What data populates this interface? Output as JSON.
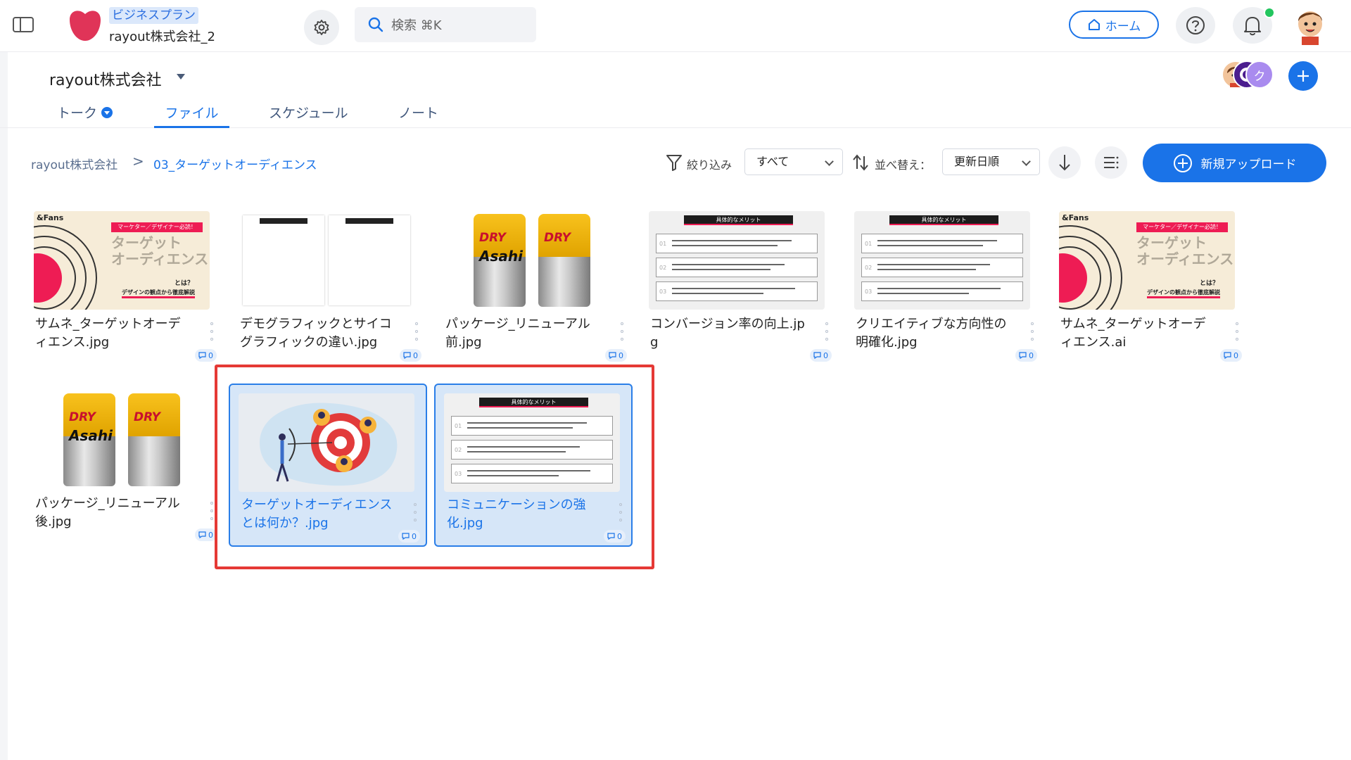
{
  "header": {
    "plan": "ビジネスプラン",
    "org": "rayout株式会社_2",
    "search_placeholder": "検索 ⌘K",
    "home_label": "ホーム"
  },
  "workspace": {
    "name": "rayout株式会社",
    "member_initial": "ク"
  },
  "tabs": [
    {
      "label": "トーク"
    },
    {
      "label": "ファイル"
    },
    {
      "label": "スケジュール"
    },
    {
      "label": "ノート"
    }
  ],
  "breadcrumb": {
    "root": "rayout株式会社",
    "separator": ">",
    "current": "03_ターゲットオーディエンス"
  },
  "toolbar": {
    "filter_label": "絞り込み",
    "filter_value": "すべて",
    "sort_label": "並べ替え：",
    "sort_value": "更新日順",
    "upload_label": "新規アップロード"
  },
  "thumb_text": {
    "fans_logo": "&Fans",
    "fans_tag": "マーケター／デザイナー必読！",
    "fans_title_1": "ターゲット",
    "fans_title_2": "オーディエンス",
    "fans_toha": "とは？",
    "fans_sub": "デザインの観点から徹底解説",
    "merit_header": "具体的なメリット",
    "can_brand_1": "DRY",
    "can_brand_2": "Asahi"
  },
  "files": [
    {
      "name": "サムネ_ターゲットオーディエンス.jpg",
      "comments": "0",
      "thumb": "fans"
    },
    {
      "name": "デモグラフィックとサイコグラフィックの違い.jpg",
      "comments": "0",
      "thumb": "doc"
    },
    {
      "name": "パッケージ_リニューアル前.jpg",
      "comments": "0",
      "thumb": "cans"
    },
    {
      "name": "コンバージョン率の向上.jpg",
      "comments": "0",
      "thumb": "merit"
    },
    {
      "name": "クリエイティブな方向性の明確化.jpg",
      "comments": "0",
      "thumb": "merit"
    },
    {
      "name": "サムネ_ターゲットオーディエンス.ai",
      "comments": "0",
      "thumb": "fans"
    },
    {
      "name": "パッケージ_リニューアル後.jpg",
      "comments": "0",
      "thumb": "cans"
    },
    {
      "name": "ターゲットオーディエンスとは何か？.jpg",
      "comments": "0",
      "thumb": "target",
      "selected": true
    },
    {
      "name": "コミュニケーションの強化.jpg",
      "comments": "0",
      "thumb": "merit",
      "selected": true
    }
  ],
  "colors": {
    "accent": "#1a73e8",
    "highlight": "#e53935",
    "brand_logo": "#e03458",
    "online": "#22c55e"
  }
}
